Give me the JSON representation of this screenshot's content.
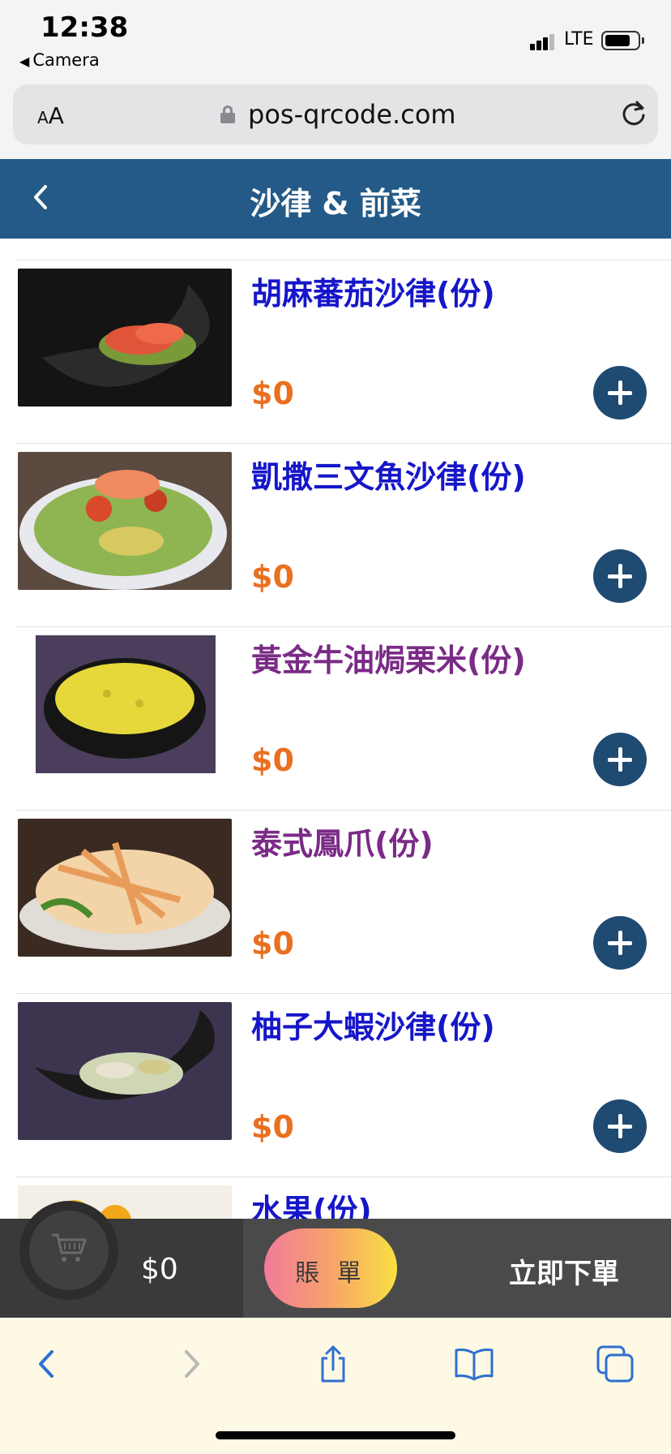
{
  "status_bar": {
    "time": "12:38",
    "back_app": "Camera",
    "network": "LTE"
  },
  "url_bar": {
    "text_size_label": "AA",
    "domain": "pos-qrcode.com"
  },
  "header": {
    "title": "沙律 & 前菜"
  },
  "menu_items": [
    {
      "name": "胡麻蕃茄沙律(份)",
      "price": "$0",
      "name_color": "#1616c9"
    },
    {
      "name": "凱撒三文魚沙律(份)",
      "price": "$0",
      "name_color": "#1616c9"
    },
    {
      "name": "黃金牛油焗栗米(份)",
      "price": "$0",
      "name_color": "#7a2b86"
    },
    {
      "name": "泰式鳳爪(份)",
      "price": "$0",
      "name_color": "#7a2b86"
    },
    {
      "name": "柚子大蝦沙律(份)",
      "price": "$0",
      "name_color": "#1616c9"
    },
    {
      "name": "水果(份)",
      "price": "",
      "name_color": "#1616c9"
    }
  ],
  "cart_bar": {
    "total": "$0",
    "bill_label": "賬 單",
    "order_label": "立即下單"
  },
  "colors": {
    "header_bg": "#245a87",
    "price": "#e9701f",
    "add_button": "#1f4a72"
  }
}
